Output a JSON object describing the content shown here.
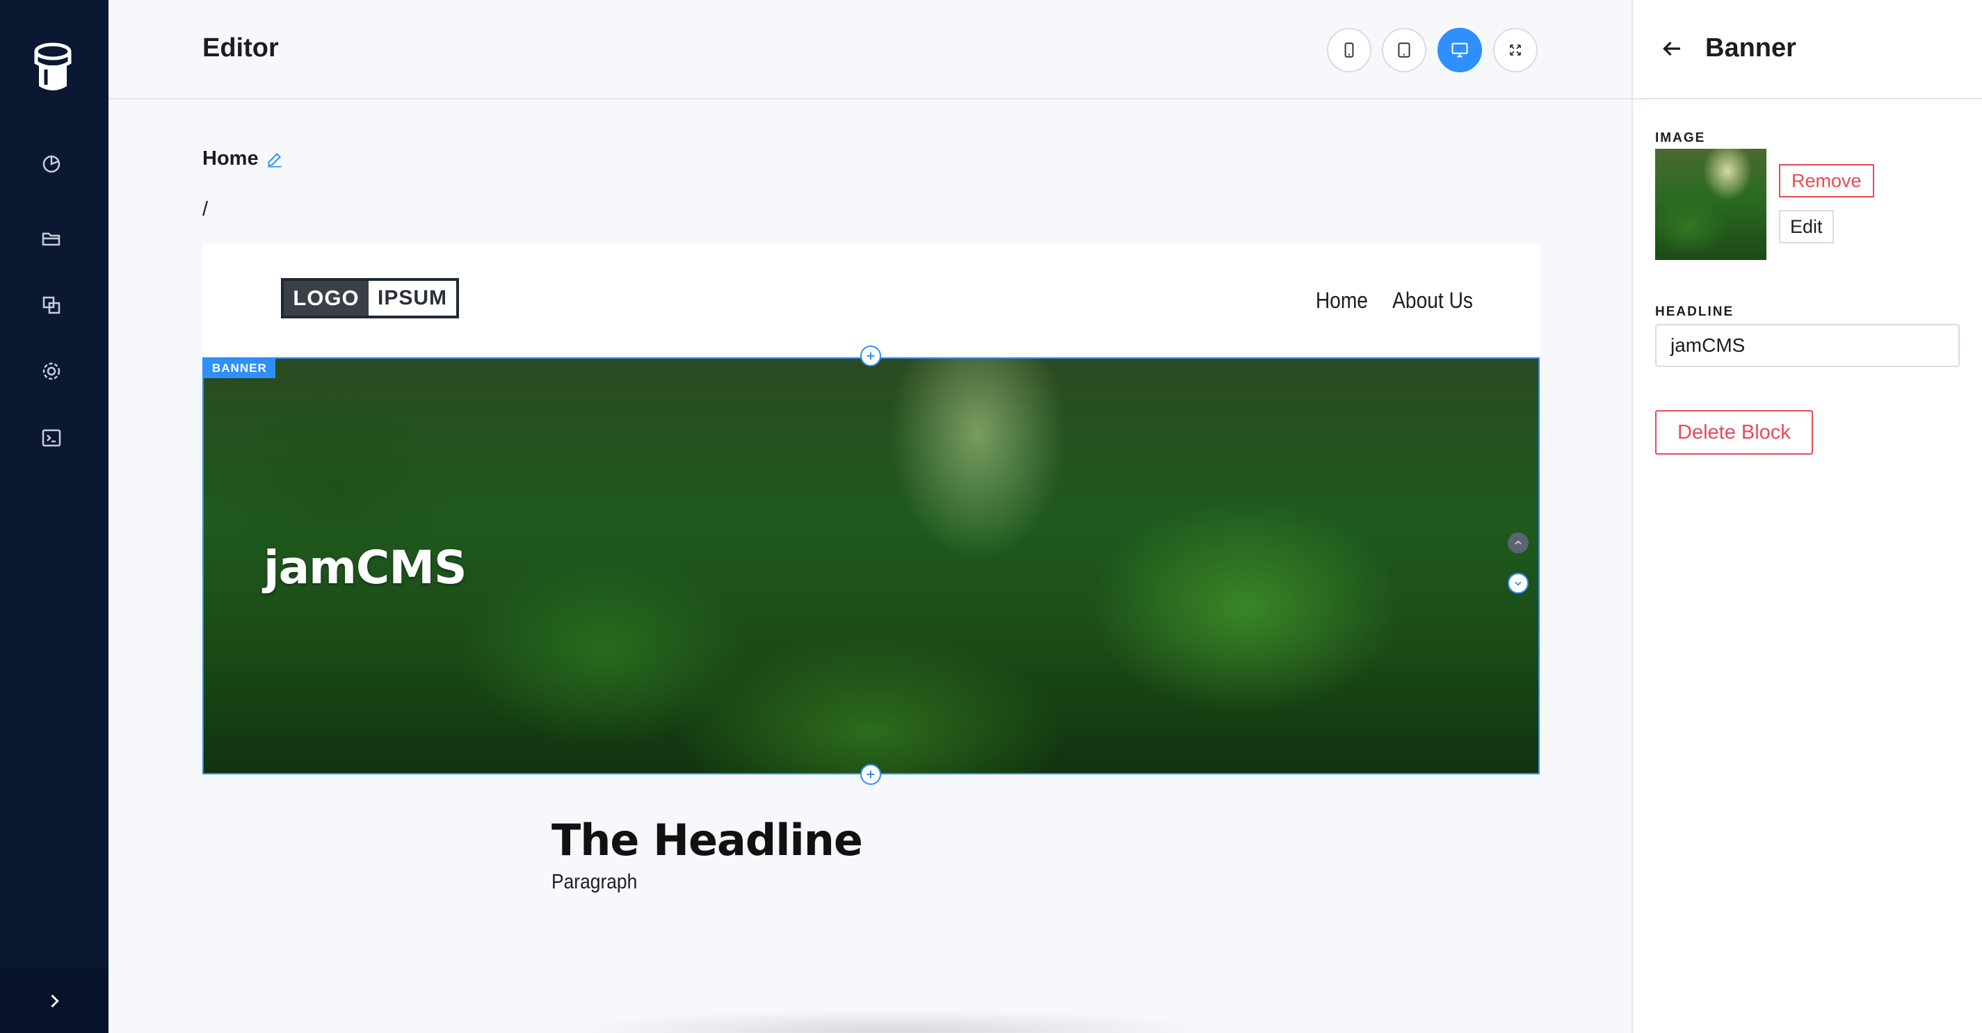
{
  "topbar": {
    "title": "Editor",
    "device_buttons": [
      {
        "icon": "phone-icon",
        "active": false
      },
      {
        "icon": "tablet-icon",
        "active": false
      },
      {
        "icon": "desktop-icon",
        "active": true
      },
      {
        "icon": "fullscreen-icon",
        "active": false
      }
    ]
  },
  "sidebar": {
    "items": [
      {
        "icon": "dashboard-icon"
      },
      {
        "icon": "folder-icon"
      },
      {
        "icon": "media-icon"
      },
      {
        "icon": "gear-icon"
      },
      {
        "icon": "terminal-icon"
      }
    ],
    "toggle_icon": "chevron-right-icon"
  },
  "page": {
    "name": "Home",
    "slug": "/"
  },
  "site": {
    "logo_part1": "LOGO",
    "logo_part2": "IPSUM",
    "nav": [
      "Home",
      "About Us"
    ]
  },
  "banner": {
    "tag": "BANNER",
    "headline": "jamCMS"
  },
  "content": {
    "headline": "The Headline",
    "paragraph": "Paragraph"
  },
  "panel": {
    "title": "Banner",
    "image_label": "IMAGE",
    "remove_label": "Remove",
    "edit_label": "Edit",
    "headline_label": "HEADLINE",
    "headline_value": "jamCMS",
    "delete_label": "Delete Block"
  },
  "colors": {
    "sidebar": "#0a1931",
    "accent": "#2f8fff",
    "danger": "#e84a56"
  }
}
